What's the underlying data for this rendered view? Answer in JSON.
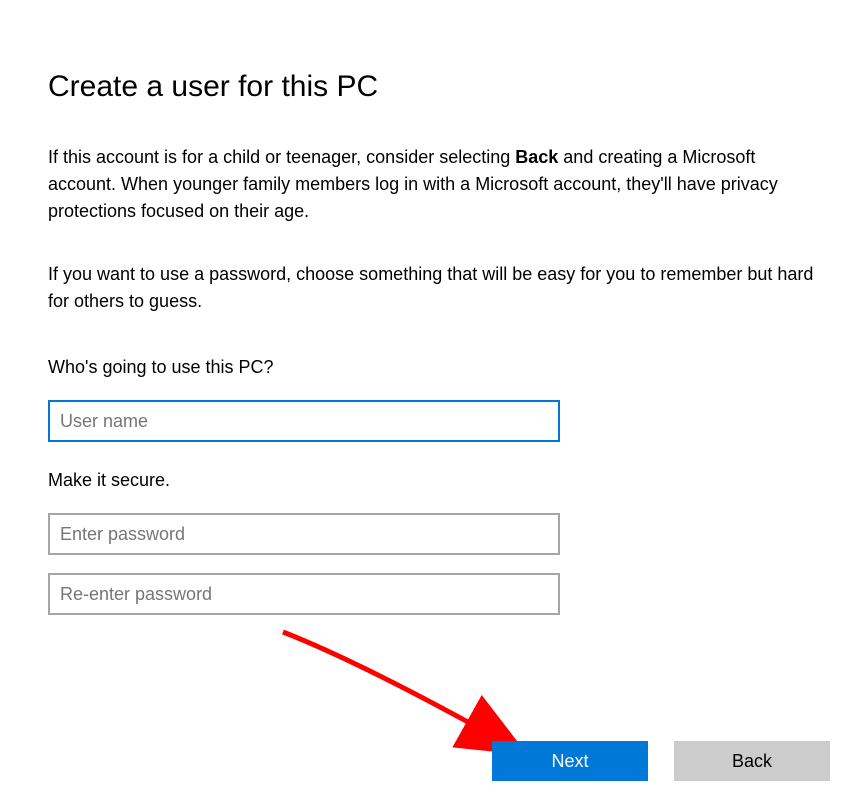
{
  "title": "Create a user for this PC",
  "description_pre": "If this account is for a child or teenager, consider selecting ",
  "description_bold": "Back",
  "description_post": " and creating a Microsoft account. When younger family members log in with a Microsoft account, they'll have privacy protections focused on their age.",
  "description2": "If you want to use a password, choose something that will be easy for you to remember but hard for others to guess.",
  "who_label": "Who's going to use this PC?",
  "username_placeholder": "User name",
  "secure_label": "Make it secure.",
  "password_placeholder": "Enter password",
  "password_confirm_placeholder": "Re-enter password",
  "buttons": {
    "next": "Next",
    "back": "Back"
  }
}
